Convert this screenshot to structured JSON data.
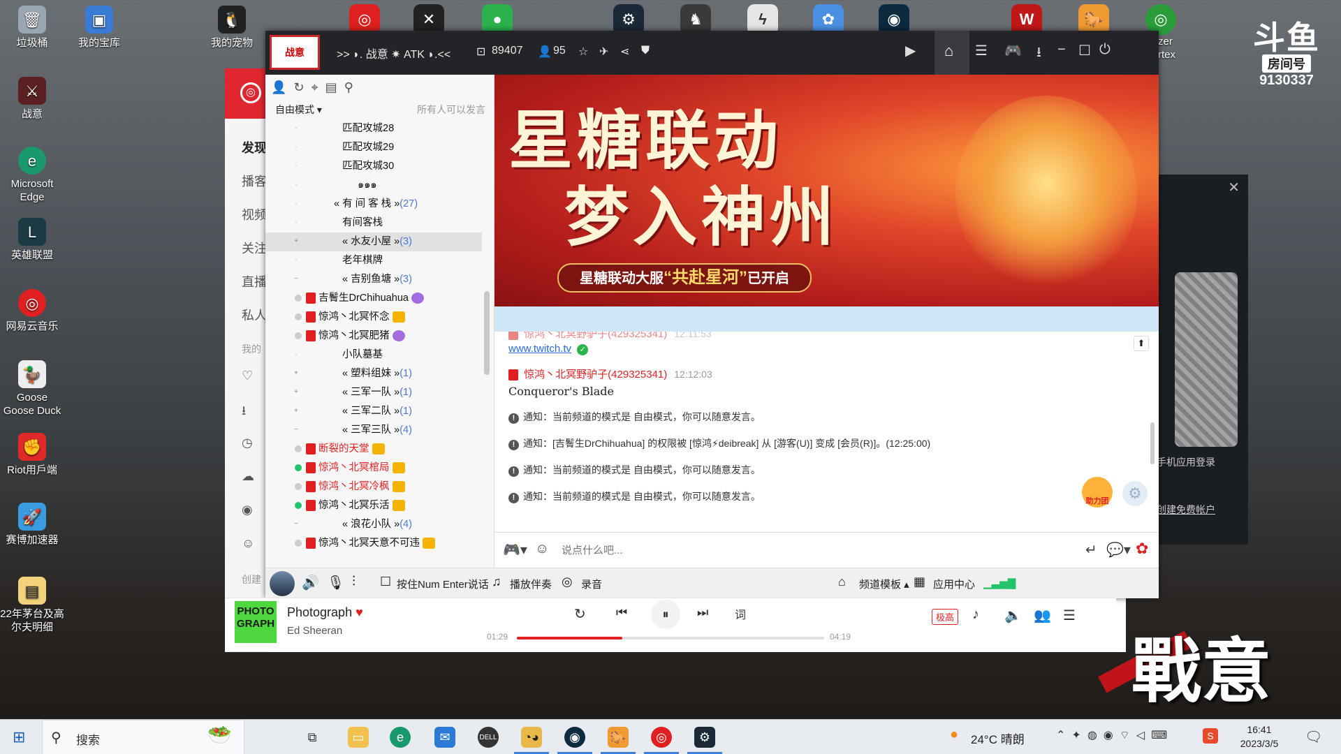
{
  "desktop": {
    "left_icons": [
      "垃圾桶",
      "战意",
      "Microsoft Edge",
      "英雄联盟",
      "网易云音乐",
      "Goose Goose Duck",
      "Riot用戶端",
      "赛博加速器",
      "22年茅台及高尔夫明细"
    ],
    "top_icons": [
      "我的宝库",
      "我的宠物"
    ],
    "top_right_partial": "zer\nrtex",
    "douyu": {
      "logo_text": "斗鱼",
      "room_label": "房间号",
      "room_id": "9130337"
    },
    "zhanyi_logo": "戰意"
  },
  "bg_window": {
    "side_items": [
      "发现",
      "播客",
      "视频",
      "关注",
      "直播",
      "私人",
      "我的",
      "创建"
    ]
  },
  "yy": {
    "title": ">> ◗. 战意 ✷ ATK ◗.<<",
    "channel_id": "89407",
    "online_count": "95",
    "mode_label": "自由模式",
    "mode_hint": "所有人可以发言",
    "tree": [
      {
        "name": "匹配攻城28",
        "pm": "·"
      },
      {
        "name": "匹配攻城29",
        "pm": "·"
      },
      {
        "name": "匹配攻城30",
        "pm": "·"
      },
      {
        "name": "๑๑๑",
        "pm": "·"
      },
      {
        "name": "有 间 客 栈",
        "pm": "·",
        "count": "(27)"
      },
      {
        "name": "有间客栈",
        "pm": "·"
      },
      {
        "name": "水友小屋",
        "pm": "+",
        "count": "(3)",
        "selected": true
      },
      {
        "name": "老年棋牌",
        "pm": "·"
      },
      {
        "name": "吉别鱼塘",
        "pm": "−",
        "count": "(3)"
      },
      {
        "name": "小队墓基",
        "pm": "·"
      },
      {
        "name": "塑料组妹",
        "pm": "+",
        "count": "(1)"
      },
      {
        "name": "三军一队",
        "pm": "+",
        "count": "(1)"
      },
      {
        "name": "三军二队",
        "pm": "+",
        "count": "(1)"
      },
      {
        "name": "三军三队",
        "pm": "−",
        "count": "(4)"
      },
      {
        "name": "浪花小队",
        "pm": "−",
        "count": "(4)"
      }
    ],
    "users": [
      {
        "name": "吉鬌生DrChihuahua",
        "red": false
      },
      {
        "name": "惊鸿丶北冥怀念",
        "red": false
      },
      {
        "name": "惊鸿丶北冥肥猪",
        "red": false
      },
      {
        "name": "断裂的天堂",
        "red": true
      },
      {
        "name": "惊鸿丶北冥棺局",
        "red": true
      },
      {
        "name": "惊鸿丶北冥冷枫",
        "red": true
      },
      {
        "name": "惊鸿丶北冥乐活",
        "red": false
      },
      {
        "name": "惊鸿丶北冥天意不可违",
        "red": false
      }
    ],
    "banner": {
      "line1": "星糖联动",
      "line2": "梦入神州",
      "sub_pre": "星糖联动大服",
      "sub_em": "“共赴星河”",
      "sub_post": "已开启"
    },
    "chat": {
      "partial_sender": "惊鸿丶北冥野驴子(429325341)",
      "partial_time": "12:11:53",
      "link": "www.twitch.tv",
      "sender": "惊鸿丶北冥野驴子(429325341)",
      "time": "12:12:03",
      "message": "Conqueror's Blade",
      "notices": [
        "通知：当前频道的模式是 自由模式，你可以随意发言。",
        "通知：[吉鬌生DrChihuahua] 的权限被 [惊鸿⚡deibreak] 从 [游客(U)] 变成 [会员(R)]。(12:25:00)",
        "通知：当前频道的模式是 自由模式，你可以随意发言。",
        "通知：当前频道的模式是 自由模式，你可以随意发言。"
      ],
      "notice_link_user": "[吉鬌生DrChihuahua]",
      "notice_link_admin": "[惊鸿⚡deibreak]",
      "fan_badge": "助力团"
    },
    "input_placeholder": "说点什么吧...",
    "bottom": {
      "ptt": "按住Num Enter说话",
      "accompany": "播放伴奏",
      "record": "录音",
      "template": "频道模板",
      "app_center": "应用中心"
    }
  },
  "player": {
    "cover_text": "PHOTO GRAPH",
    "title": "Photograph",
    "artist": "Ed Sheeran",
    "elapsed": "01:29",
    "duration": "04:19",
    "progress": 0.344,
    "lyrics_btn": "词",
    "quality": "极高"
  },
  "dialog": {
    "text1": "手机应用登录",
    "text2": "创建免费帐户"
  },
  "taskbar": {
    "search": "搜索",
    "weather_temp": "24°C",
    "weather": "晴朗",
    "time": "16:41",
    "date": "2023/3/5"
  },
  "colors": {
    "accent_red": "#e02020",
    "yy_dark": "#232427",
    "taskbar": "#e8ecf0"
  }
}
